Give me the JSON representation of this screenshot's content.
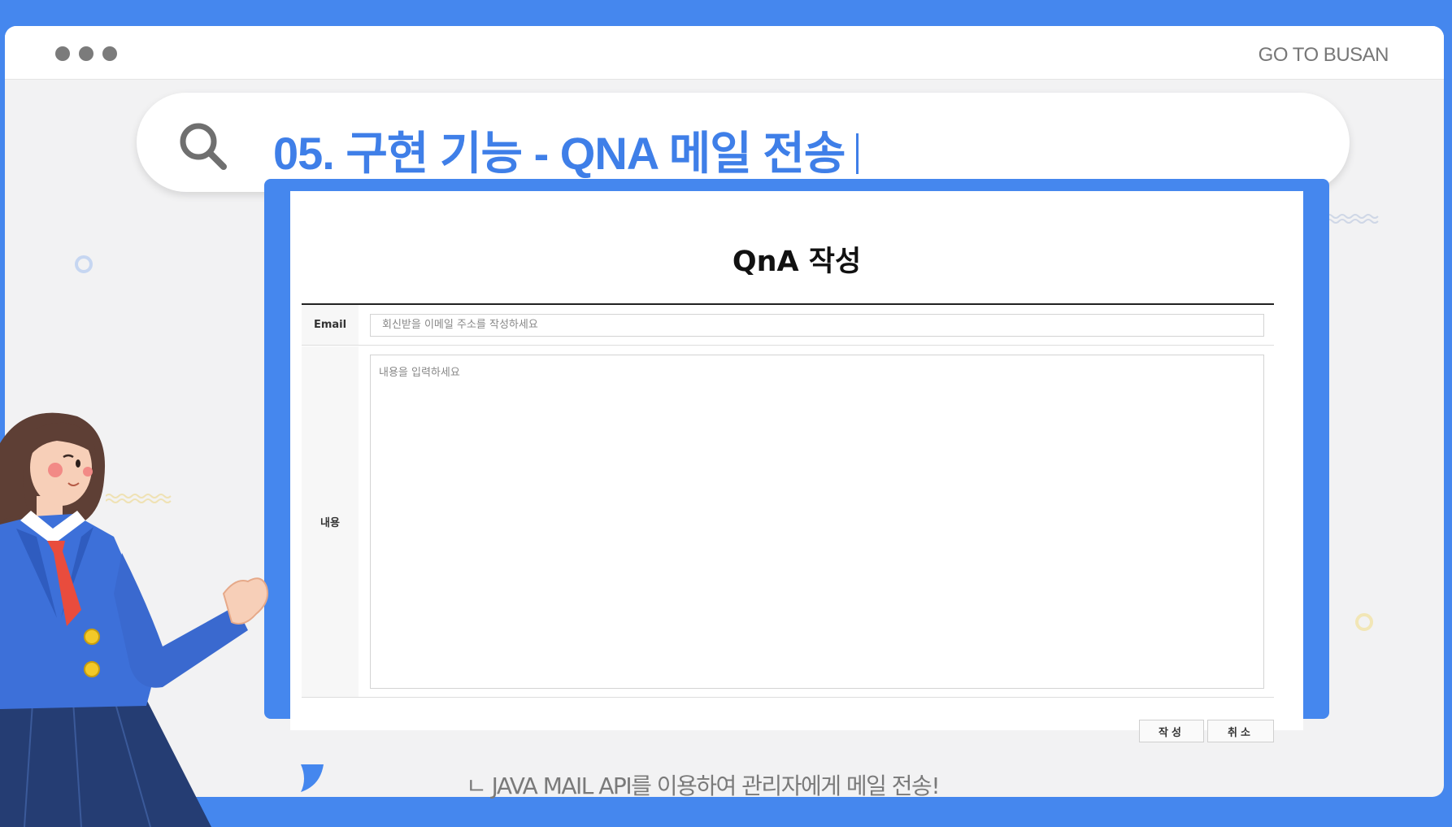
{
  "window": {
    "brand": "GO TO BUSAN",
    "controls": [
      "dot-1",
      "dot-2",
      "dot-3"
    ]
  },
  "search": {
    "title": "05. 구현 기능 - QNA 메일 전송",
    "icon": "search-icon"
  },
  "form": {
    "title": "QnA 작성",
    "email_label": "Email",
    "email_placeholder": "회신받을 이메일 주소를 작성하세요",
    "content_label": "내용",
    "content_placeholder": "내용을 입력하세요",
    "submit_label": "작성",
    "cancel_label": "취소"
  },
  "caption": "ㄴ JAVA MAIL API를 이용하여 관리자에게 메일 전송!",
  "colors": {
    "accent": "#4587ee",
    "title_blue": "#3f7fe8",
    "window_bg": "#f2f2f3"
  }
}
